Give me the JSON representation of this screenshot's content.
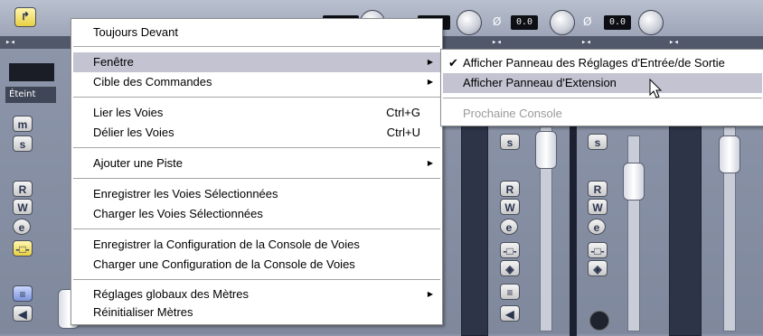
{
  "mixer": {
    "eteint_label": "Éteint",
    "value_readouts": [
      "0.0",
      "0.0"
    ],
    "phase_symbol": "Ø",
    "buttons": {
      "mute": "m",
      "solo": "s",
      "read": "R",
      "write": "W",
      "edit": "e"
    }
  },
  "main_menu": {
    "items": [
      {
        "label": "Toujours Devant",
        "shortcut": "",
        "has_submenu": false
      },
      {
        "label": "Fenêtre",
        "shortcut": "",
        "has_submenu": true,
        "highlighted": true
      },
      {
        "label": "Cible des Commandes",
        "shortcut": "",
        "has_submenu": true
      },
      {
        "label": "Lier les Voies",
        "shortcut": "Ctrl+G",
        "has_submenu": false
      },
      {
        "label": "Délier les Voies",
        "shortcut": "Ctrl+U",
        "has_submenu": false
      },
      {
        "label": "Ajouter une Piste",
        "shortcut": "",
        "has_submenu": true
      },
      {
        "label": "Enregistrer les Voies Sélectionnées",
        "shortcut": "",
        "has_submenu": false
      },
      {
        "label": "Charger les Voies Sélectionnées",
        "shortcut": "",
        "has_submenu": false
      },
      {
        "label": "Enregistrer la Configuration de la Console de Voies",
        "shortcut": "",
        "has_submenu": false
      },
      {
        "label": "Charger une Configuration de la Console de Voies",
        "shortcut": "",
        "has_submenu": false
      },
      {
        "label": "Réglages globaux des Mètres",
        "shortcut": "",
        "has_submenu": true
      },
      {
        "label": "Réinitialiser Mètres",
        "shortcut": "",
        "has_submenu": false
      }
    ]
  },
  "sub_menu": {
    "items": [
      {
        "label": "Afficher Panneau des Réglages d'Entrée/de Sortie",
        "checked": true,
        "disabled": false
      },
      {
        "label": "Afficher Panneau d'Extension",
        "checked": false,
        "highlighted": true,
        "disabled": false
      },
      {
        "label": "Prochaine Console",
        "checked": false,
        "disabled": true
      }
    ]
  },
  "icons": {
    "checkmark": "✔",
    "submenu_arrow": "▶"
  },
  "colors": {
    "menu_highlight": "#c4c3d2",
    "mixer_bg": "#8b93a8"
  }
}
